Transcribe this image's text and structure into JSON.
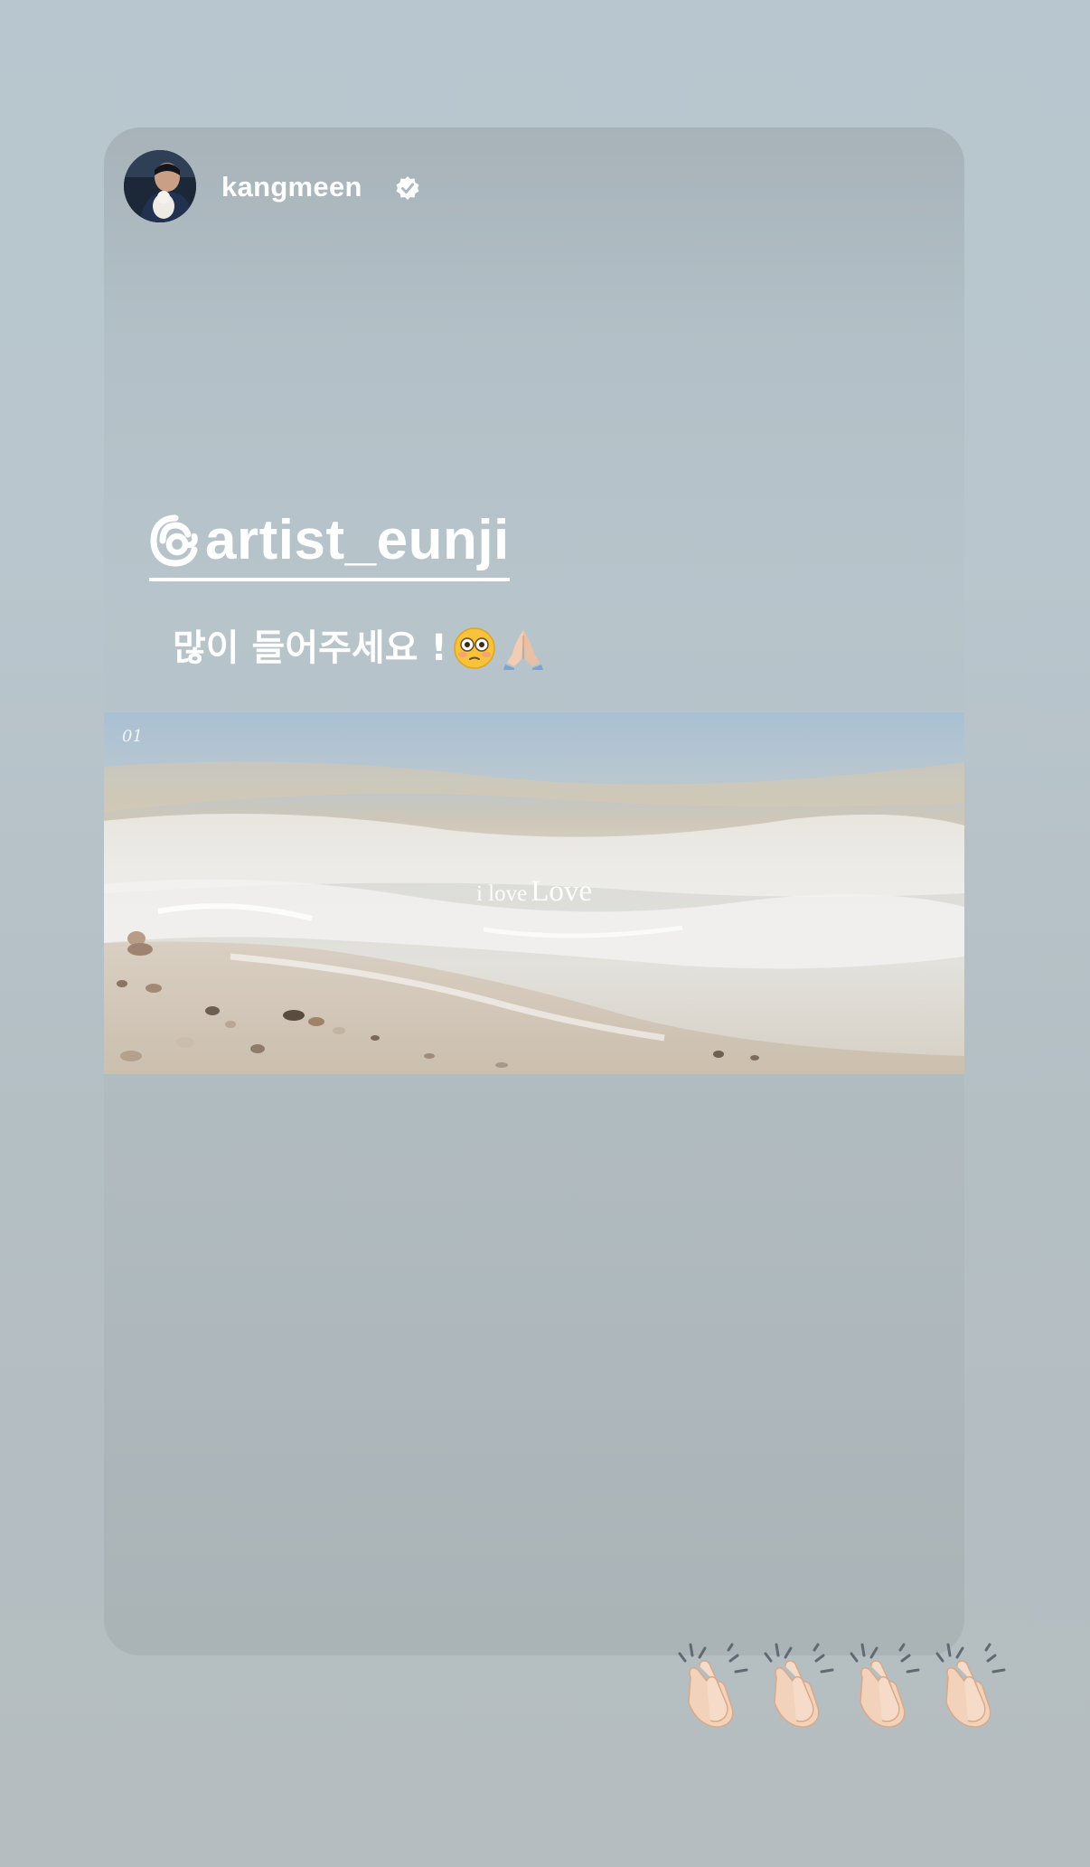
{
  "story": {
    "username": "kangmeen",
    "verified_icon": "verified-badge-icon",
    "mention_icon": "threads-icon",
    "mention": "artist_eunji",
    "caption": "많이 들어주세요 !",
    "caption_emojis": [
      "flushed-face-emoji",
      "folded-hands-emoji"
    ],
    "video": {
      "track_number": "01",
      "title_small": "i love",
      "title_big": "Love"
    },
    "sticker": {
      "emoji": "clapping-hands-emoji",
      "count": 4
    }
  }
}
